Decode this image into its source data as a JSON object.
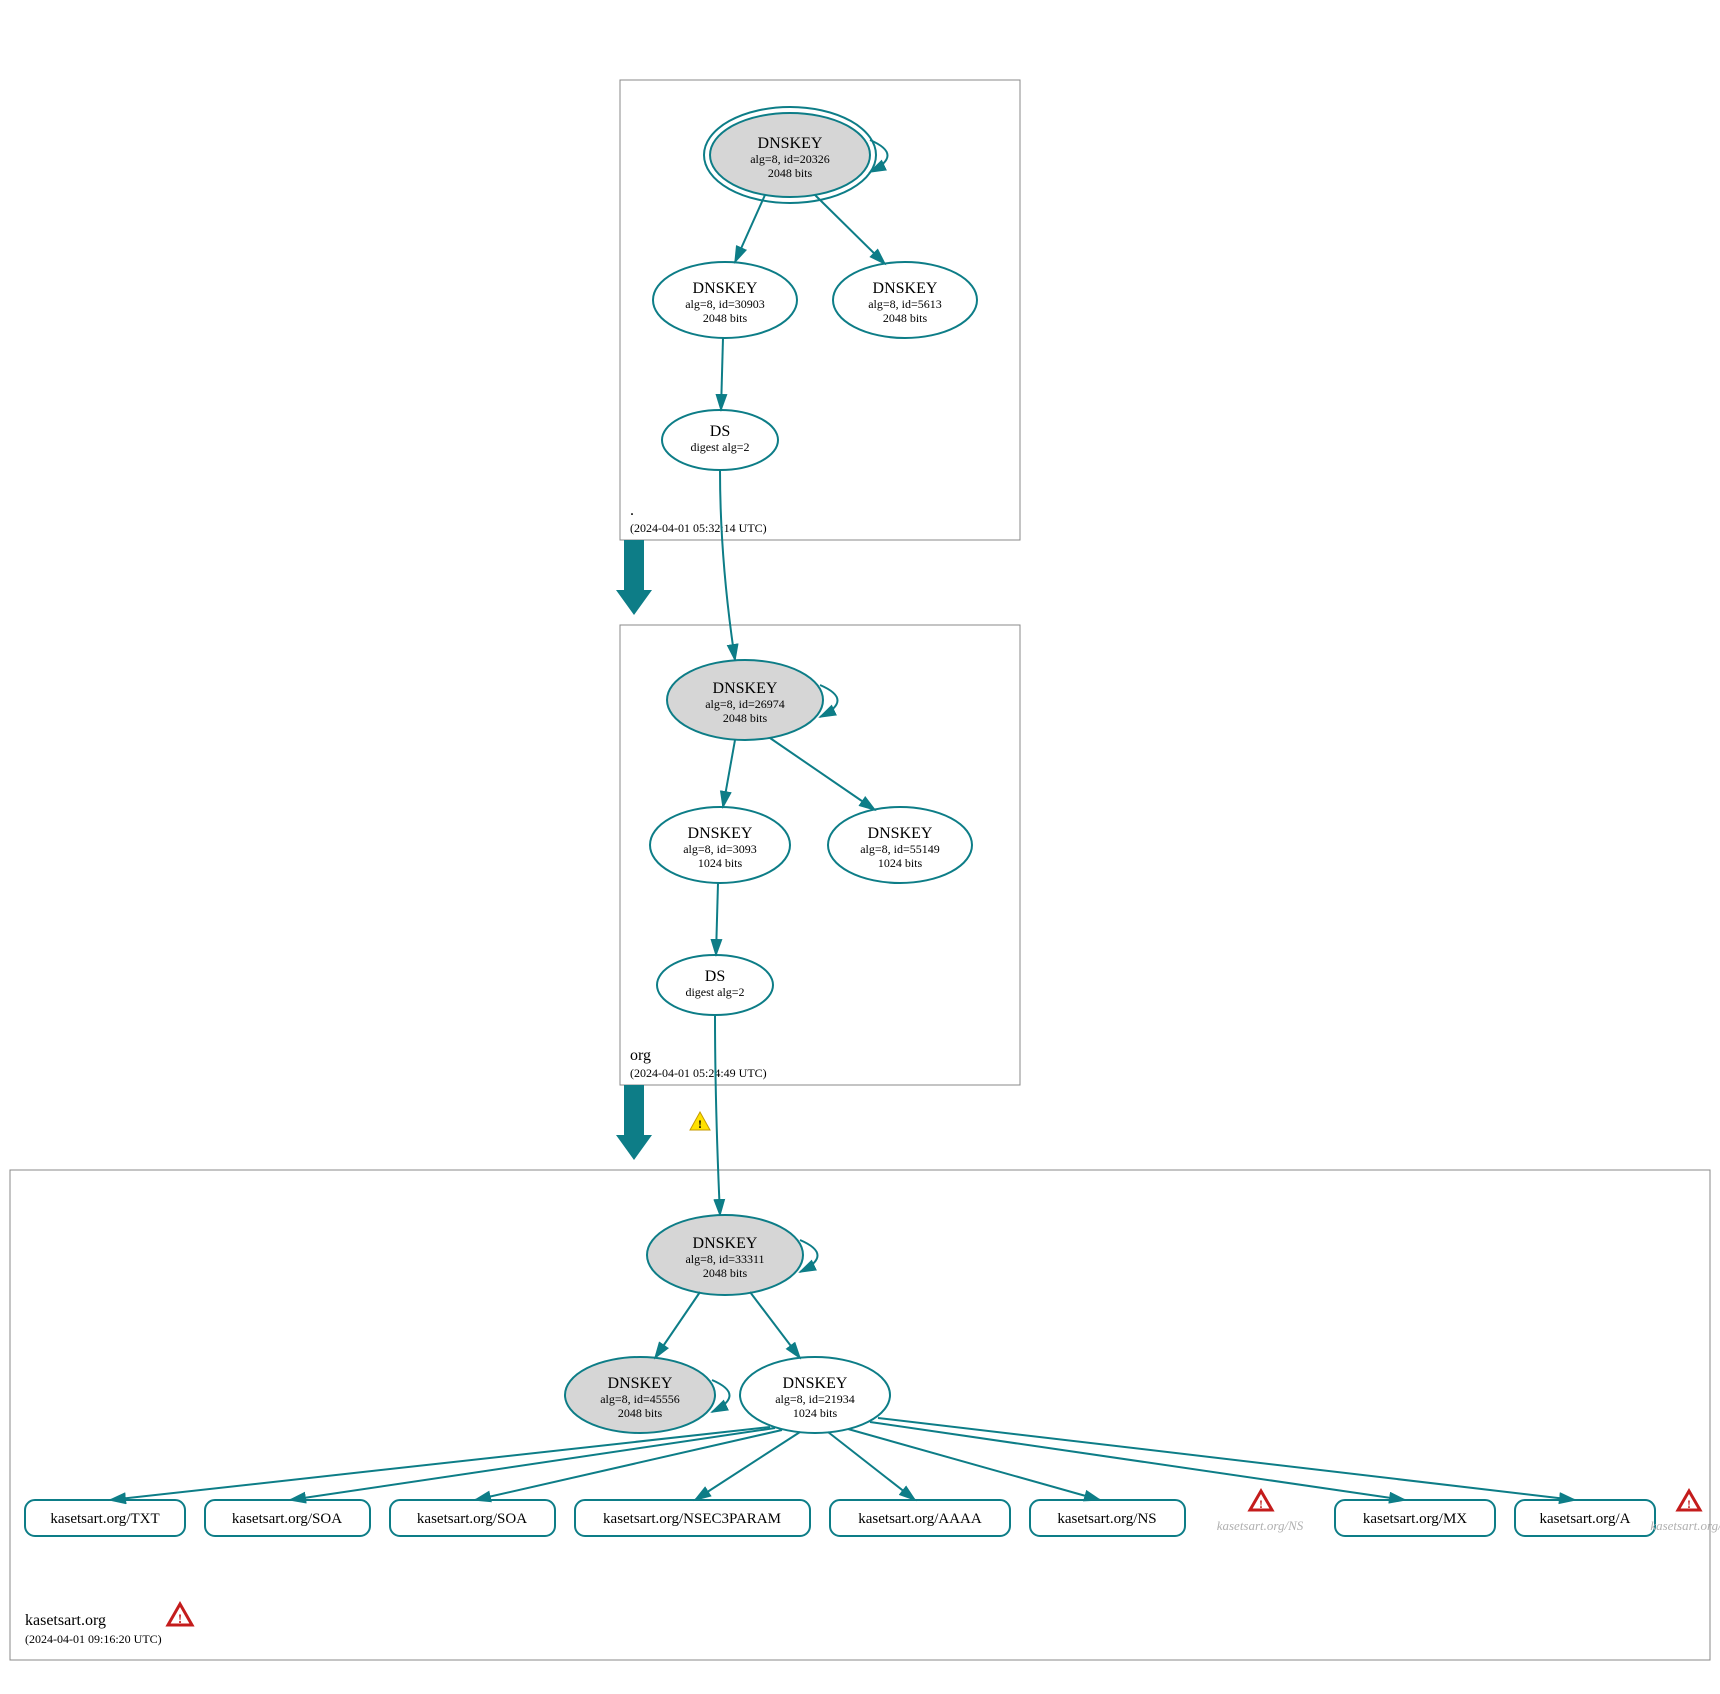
{
  "colors": {
    "stroke": "#0d7d87",
    "greyFill": "#d6d6d6"
  },
  "zones": {
    "root": {
      "label": ".",
      "time": "(2024-04-01 05:32:14 UTC)"
    },
    "org": {
      "label": "org",
      "time": "(2024-04-01 05:24:49 UTC)"
    },
    "domain": {
      "label": "kasetsart.org",
      "time": "(2024-04-01 09:16:20 UTC)"
    }
  },
  "nodes": {
    "root_ksk": {
      "title": "DNSKEY",
      "l1": "alg=8, id=20326",
      "l2": "2048 bits"
    },
    "root_zsk1": {
      "title": "DNSKEY",
      "l1": "alg=8, id=30903",
      "l2": "2048 bits"
    },
    "root_zsk2": {
      "title": "DNSKEY",
      "l1": "alg=8, id=5613",
      "l2": "2048 bits"
    },
    "root_ds": {
      "title": "DS",
      "l1": "digest alg=2"
    },
    "org_ksk": {
      "title": "DNSKEY",
      "l1": "alg=8, id=26974",
      "l2": "2048 bits"
    },
    "org_zsk1": {
      "title": "DNSKEY",
      "l1": "alg=8, id=3093",
      "l2": "1024 bits"
    },
    "org_zsk2": {
      "title": "DNSKEY",
      "l1": "alg=8, id=55149",
      "l2": "1024 bits"
    },
    "org_ds": {
      "title": "DS",
      "l1": "digest alg=2"
    },
    "dom_ksk": {
      "title": "DNSKEY",
      "l1": "alg=8, id=33311",
      "l2": "2048 bits"
    },
    "dom_zsk1": {
      "title": "DNSKEY",
      "l1": "alg=8, id=45556",
      "l2": "2048 bits"
    },
    "dom_zsk2": {
      "title": "DNSKEY",
      "l1": "alg=8, id=21934",
      "l2": "1024 bits"
    }
  },
  "records": {
    "txt": "kasetsart.org/TXT",
    "soa1": "kasetsart.org/SOA",
    "soa2": "kasetsart.org/SOA",
    "nsec3": "kasetsart.org/NSEC3PARAM",
    "aaaa": "kasetsart.org/AAAA",
    "ns": "kasetsart.org/NS",
    "ns_err": "kasetsart.org/NS",
    "mx": "kasetsart.org/MX",
    "a": "kasetsart.org/A",
    "a_err": "kasetsart.org/A"
  },
  "warn_glyph": "!",
  "err_glyph": "!"
}
